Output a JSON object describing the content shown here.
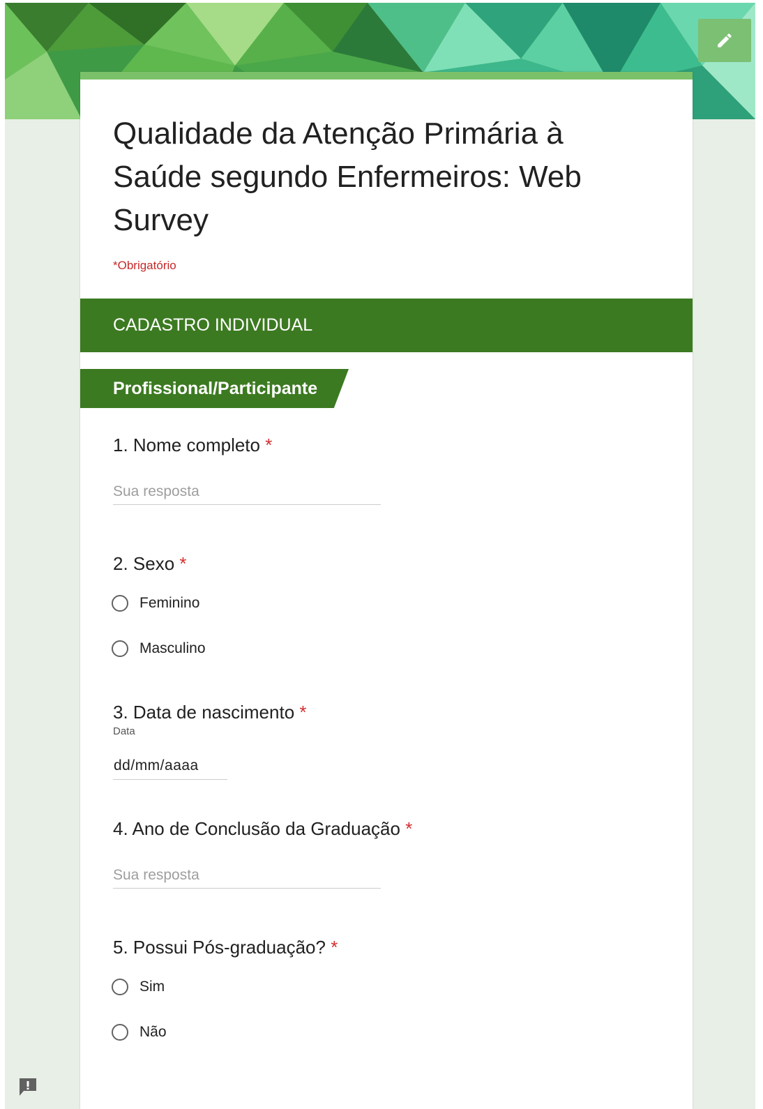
{
  "form": {
    "title": "Qualidade da Atenção Primária à Saúde segundo Enfermeiros: Web Survey",
    "required_note": "*Obrigatório",
    "section_header": "CADASTRO INDIVIDUAL",
    "subsection_title": "Profissional/Participante"
  },
  "questions": {
    "q1": {
      "title": "1. Nome completo",
      "required_mark": "*",
      "placeholder": "Sua resposta"
    },
    "q2": {
      "title": "2. Sexo",
      "required_mark": "*",
      "options": [
        "Feminino",
        "Masculino"
      ]
    },
    "q3": {
      "title": "3. Data de nascimento",
      "required_mark": "*",
      "helper": "Data",
      "date_placeholder": "dd/mm/aaaa"
    },
    "q4": {
      "title": "4. Ano de Conclusão da Graduação",
      "required_mark": "*",
      "placeholder": "Sua resposta"
    },
    "q5": {
      "title": "5. Possui Pós-graduação?",
      "required_mark": "*",
      "options": [
        "Sim",
        "Não"
      ]
    }
  },
  "icons": {
    "edit": "pencil-icon",
    "feedback": "feedback-icon"
  },
  "colors": {
    "section_green": "#3c7a21",
    "accent_green": "#7bc169",
    "required_red": "#d32f2f",
    "page_background": "#e8efe6"
  }
}
